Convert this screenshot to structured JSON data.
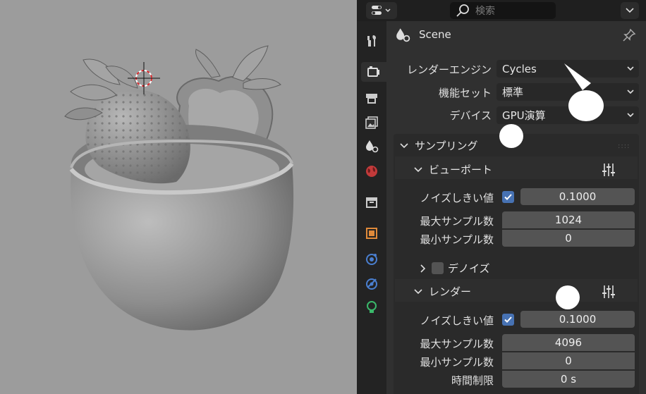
{
  "header": {
    "search_placeholder": "検索"
  },
  "context": {
    "scene_name": "Scene"
  },
  "render": {
    "engine_label": "レンダーエンジン",
    "engine_value": "Cycles",
    "feature_set_label": "機能セット",
    "feature_set_value": "標準",
    "device_label": "デバイス",
    "device_value": "GPU演算"
  },
  "sampling": {
    "title": "サンプリング",
    "viewport": {
      "title": "ビューポート",
      "noise_threshold_label": "ノイズしきい値",
      "noise_threshold_enabled": true,
      "noise_threshold_value": "0.1000",
      "max_samples_label": "最大サンプル数",
      "max_samples_value": "1024",
      "min_samples_label": "最小サンプル数",
      "min_samples_value": "0",
      "denoise_label": "デノイズ",
      "denoise_enabled": false
    },
    "render": {
      "title": "レンダー",
      "noise_threshold_label": "ノイズしきい値",
      "noise_threshold_enabled": true,
      "noise_threshold_value": "0.1000",
      "max_samples_label": "最大サンプル数",
      "max_samples_value": "4096",
      "min_samples_label": "最小サンプル数",
      "min_samples_value": "0",
      "time_limit_label": "時間制限",
      "time_limit_value": "0 s"
    }
  },
  "colors": {
    "accent": "#4772b3",
    "panel_bg": "#303030",
    "field_bg": "#545454",
    "viewport_bg": "#9c9c9c"
  },
  "icons": {
    "tabs": [
      "tool-icon",
      "render-icon",
      "output-icon",
      "view-layer-icon",
      "scene-icon",
      "world-icon",
      "collection-icon",
      "object-icon",
      "physics-icon",
      "constraints-icon",
      "data-icon"
    ]
  }
}
